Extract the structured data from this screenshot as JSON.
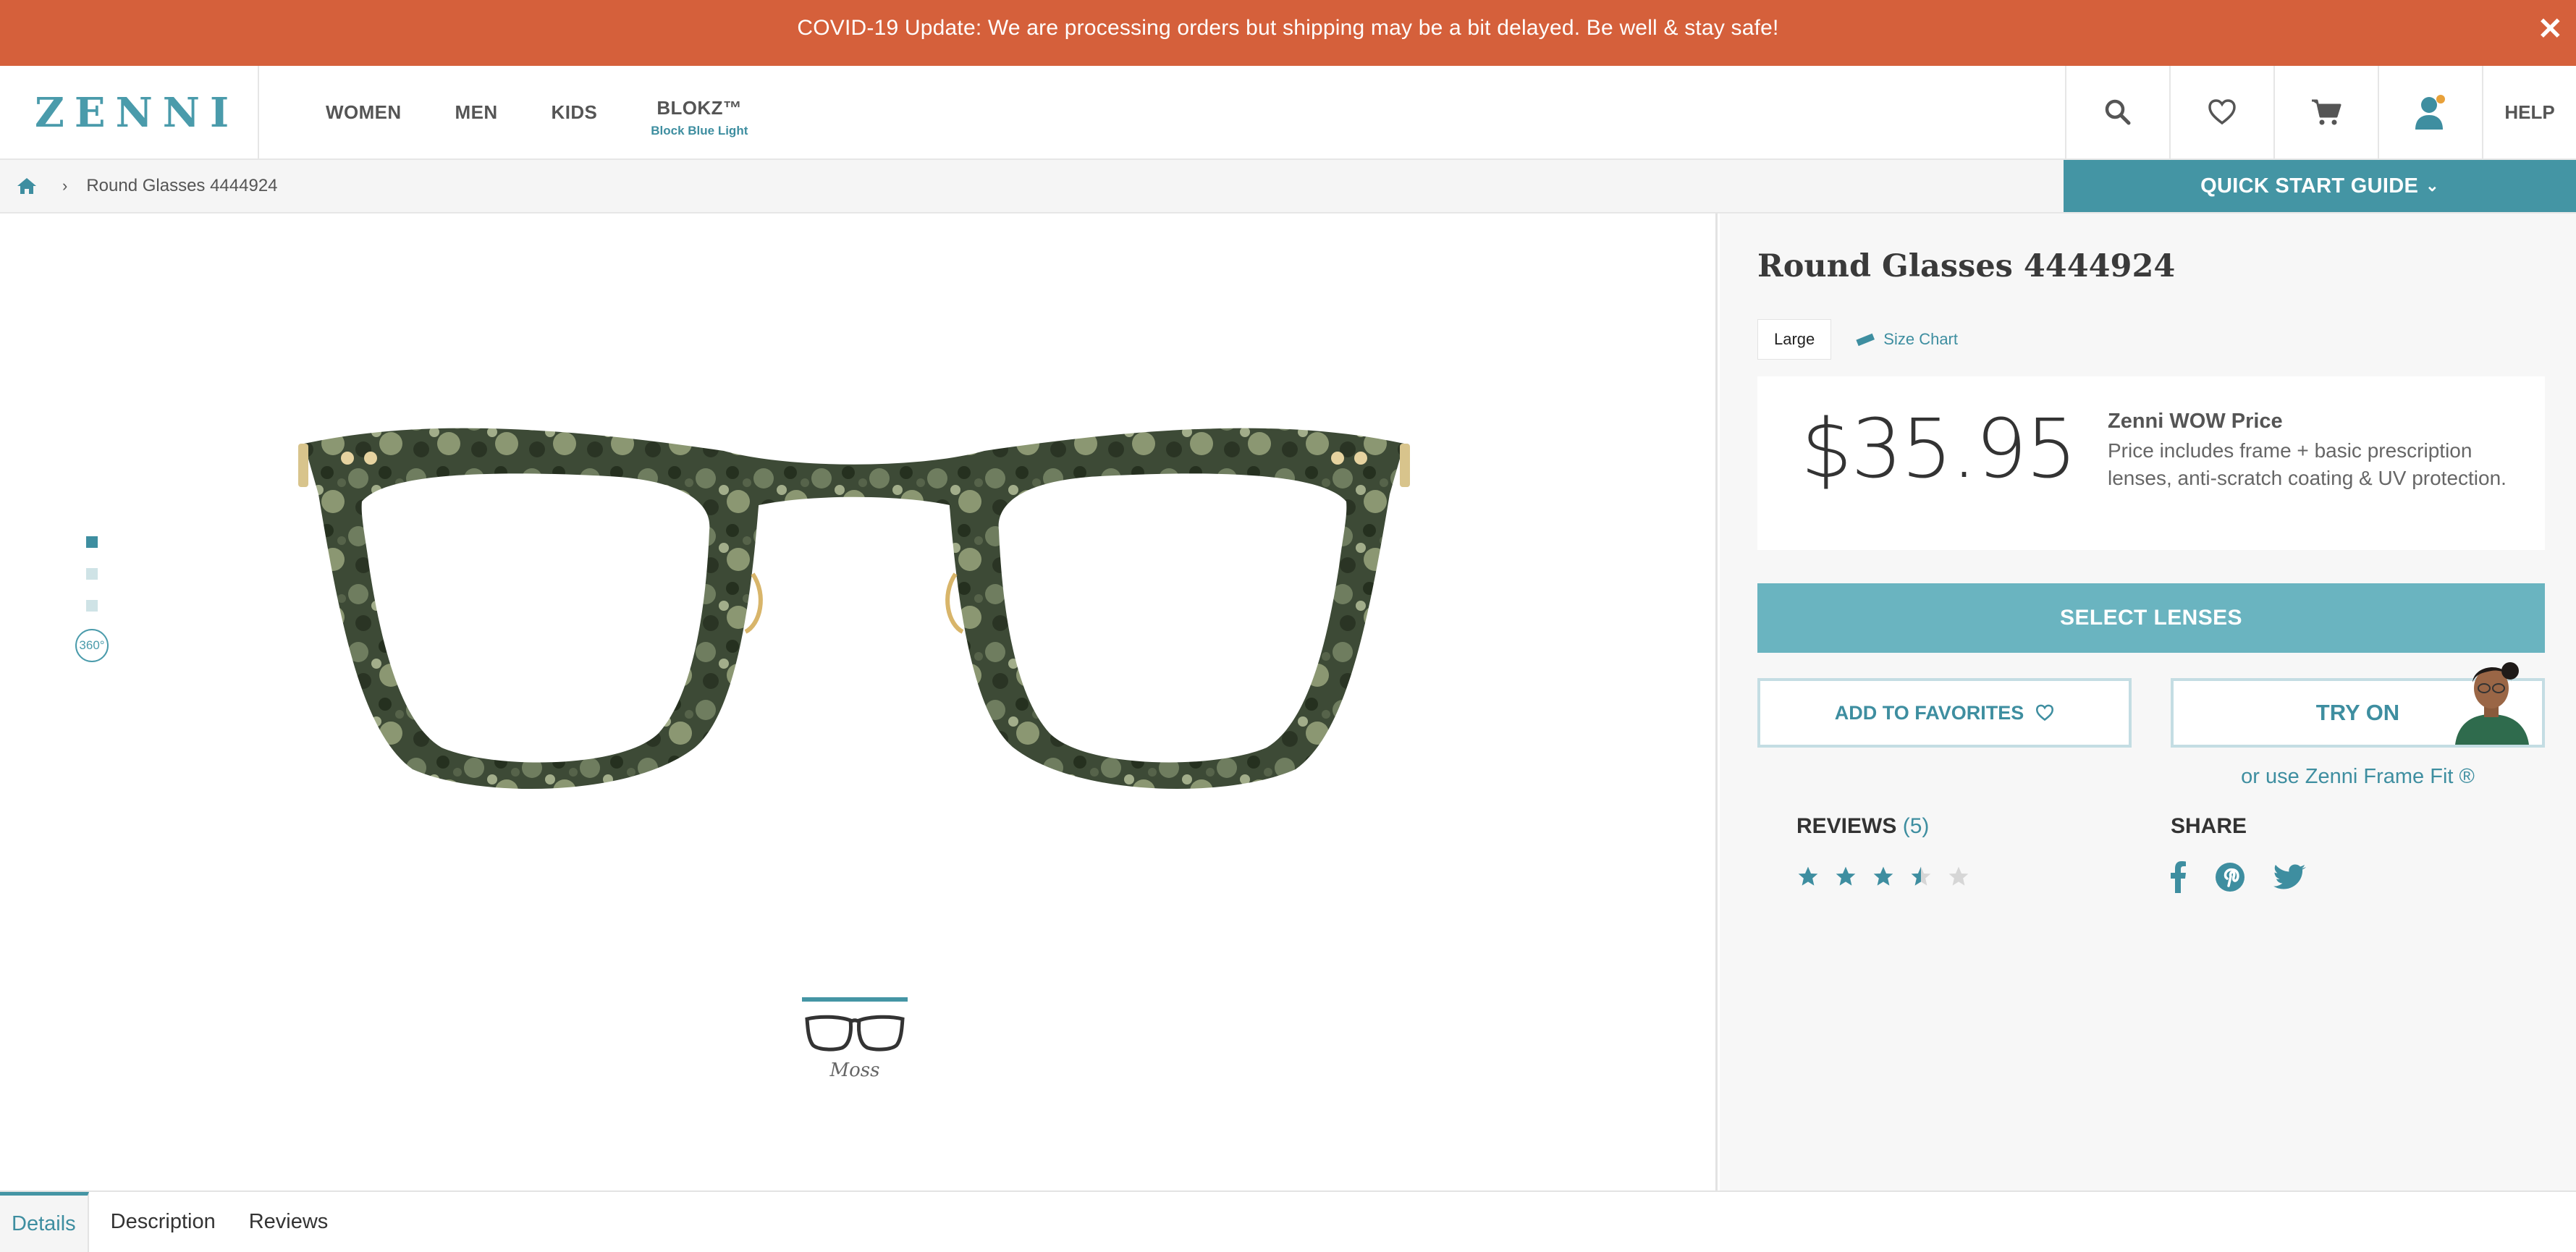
{
  "banner": {
    "text": "COVID-19 Update: We are processing orders but shipping may be a bit delayed. Be well & stay safe!",
    "close": "✕"
  },
  "header": {
    "logo": "ZENNI",
    "nav": [
      {
        "label": "WOMEN"
      },
      {
        "label": "MEN"
      },
      {
        "label": "KIDS"
      }
    ],
    "blokz": {
      "label": "BLOKZ™",
      "sub": "Block Blue Light"
    },
    "icons": [
      "search-icon",
      "heart-icon",
      "cart-icon",
      "account-icon"
    ],
    "help": "HELP"
  },
  "breadcrumb": {
    "current": "Round Glasses 4444924"
  },
  "quick_start": {
    "label": "QUICK START GUIDE"
  },
  "gallery": {
    "dots": 3,
    "active_dot": 0,
    "view360": "360°",
    "color_label": "Moss"
  },
  "product": {
    "title": "Round Glasses 4444924",
    "size": "Large",
    "size_chart": "Size Chart",
    "price": "$35.95",
    "wow_title": "Zenni WOW Price",
    "wow_desc": "Price includes frame + basic prescription lenses, anti-scratch coating & UV protection.",
    "select_lenses": "SELECT LENSES",
    "add_to_favorites": "ADD TO FAVORITES",
    "try_on": "TRY ON",
    "frame_fit": "or use Zenni Frame Fit ®",
    "reviews_label": "REVIEWS",
    "reviews_count": "(5)",
    "rating": 3.5,
    "rating_max": 5,
    "share_label": "SHARE",
    "share_icons": [
      "facebook-icon",
      "pinterest-icon",
      "twitter-icon"
    ]
  },
  "tabs": [
    {
      "label": "Details",
      "active": true
    },
    {
      "label": "Description",
      "active": false
    },
    {
      "label": "Reviews",
      "active": false
    }
  ],
  "colors": {
    "banner": "#d5603b",
    "accent": "#4495a4",
    "select_lenses": "#6ab4c0",
    "star": "#3e8ea0",
    "star_empty": "#d6d6d6"
  }
}
